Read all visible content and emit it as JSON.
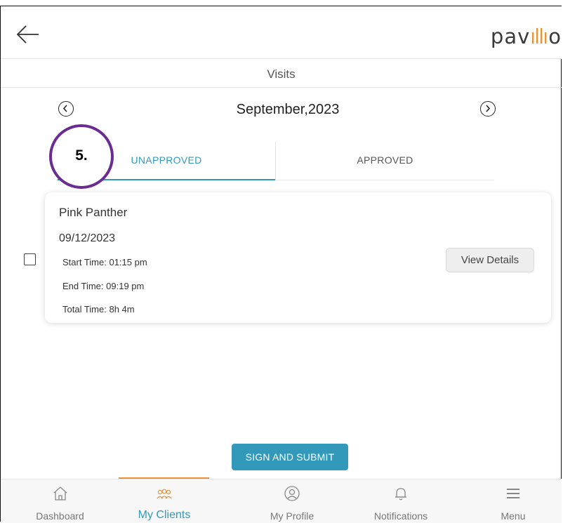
{
  "header": {
    "logo_text": "pavillio",
    "logo_prefix": "pav",
    "logo_suffix": "o",
    "logo_accent_color": "#e6943a"
  },
  "subheader": {
    "title": "Visits"
  },
  "month_nav": {
    "label": "September,2023"
  },
  "tabs": [
    {
      "label": "UNAPPROVED",
      "active": true
    },
    {
      "label": "APPROVED",
      "active": false
    }
  ],
  "annotation": {
    "step_label": "5."
  },
  "visit": {
    "client_name": "Pink Panther",
    "date": "09/12/2023",
    "start_time": "Start Time: 01:15 pm",
    "end_time": "End Time: 09:19 pm",
    "total_time": "Total Time: 8h 4m",
    "view_details_label": "View Details",
    "checked": false
  },
  "actions": {
    "sign_submit_label": "SIGN AND SUBMIT"
  },
  "bottom_nav": [
    {
      "label": "Dashboard",
      "icon": "home-icon",
      "active": false
    },
    {
      "label": "My Clients",
      "icon": "clients-icon",
      "active": true
    },
    {
      "label": "My Profile",
      "icon": "profile-icon",
      "active": false
    },
    {
      "label": "Notifications",
      "icon": "bell-icon",
      "active": false
    },
    {
      "label": "Menu",
      "icon": "hamburger-menu-icon",
      "active": false
    }
  ],
  "colors": {
    "accent": "#3399bb",
    "nav_indicator": "#e6943a",
    "annotation_ring": "#6b2c91"
  }
}
